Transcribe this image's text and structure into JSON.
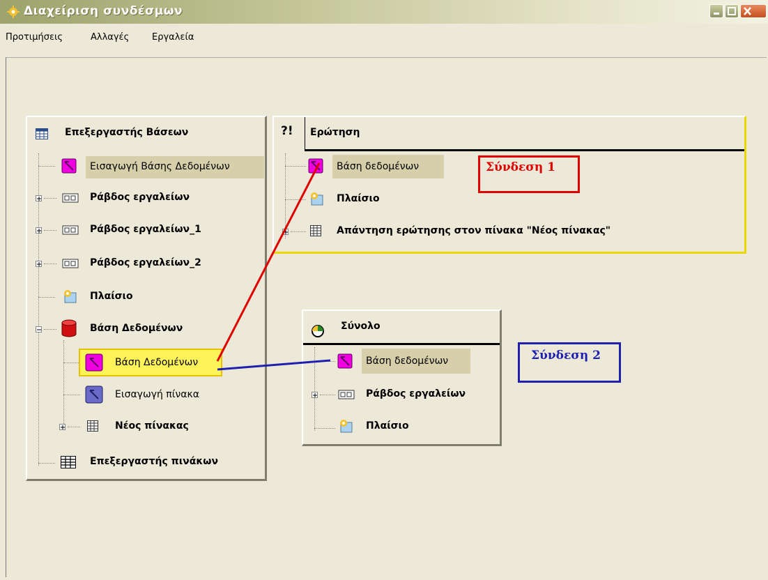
{
  "window": {
    "title": "Διαχείριση συνδέσμων"
  },
  "menu": [
    "Προτιμήσεις",
    "Αλλαγές",
    "Εργαλεία"
  ],
  "db_panel": {
    "title": "Επεξεργαστής Βάσεων",
    "items": [
      {
        "label": "Εισαγωγή Βάσης Δεδομένων"
      },
      {
        "label": "Ράβδος εργαλείων"
      },
      {
        "label": "Ράβδος εργαλείων_1"
      },
      {
        "label": "Ράβδος εργαλείων_2"
      },
      {
        "label": "Πλαίσιο"
      },
      {
        "label": "Βάση Δεδομένων"
      },
      {
        "label": "Βάση Δεδομένων"
      },
      {
        "label": "Εισαγωγή πίνακα"
      },
      {
        "label": "Νέος πίνακας"
      },
      {
        "label": "Επεξεργαστής πινάκων"
      }
    ]
  },
  "query_panel": {
    "title": "Ερώτηση",
    "icon_text": "?!",
    "items": [
      {
        "label": "Βάση δεδομένων"
      },
      {
        "label": "Πλαίσιο"
      },
      {
        "label": "Απάντηση ερώτησης στον πίνακα \"Νέος πίνακας\""
      }
    ]
  },
  "set_panel": {
    "title": "Σύνολο",
    "items": [
      {
        "label": "Βάση δεδομένων"
      },
      {
        "label": "Ράβδος εργαλείων"
      },
      {
        "label": "Πλαίσιο"
      }
    ]
  },
  "annotations": {
    "link1": {
      "label": "Σύνδεση 1",
      "color": "#E00000"
    },
    "link2": {
      "label": "Σύνδεση 2",
      "color": "#2020B0"
    }
  }
}
